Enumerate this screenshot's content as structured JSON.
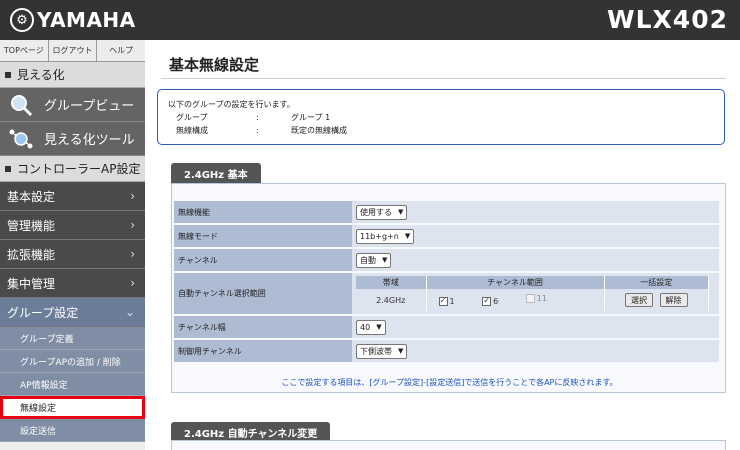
{
  "header": {
    "logo_mark": "⚙",
    "brand": "YAMAHA",
    "model": "WLX402",
    "background_color": "#333333"
  },
  "sidebar": {
    "topnav": [
      "TOPページ",
      "ログアウト",
      "ヘルプ"
    ],
    "section_visualize": "見える化",
    "tools": [
      {
        "label": "グループビュー",
        "icon": "magnifier-icon"
      },
      {
        "label": "見える化ツール",
        "icon": "network-tool-icon"
      }
    ],
    "section_controller": "コントローラーAP設定",
    "menu": [
      {
        "label": "基本設定"
      },
      {
        "label": "管理機能"
      },
      {
        "label": "拡張機能"
      },
      {
        "label": "集中管理"
      },
      {
        "label": "グループ設定"
      }
    ],
    "submenu": [
      {
        "label": "グループ定義"
      },
      {
        "label": "グループAPの追加 / 削除"
      },
      {
        "label": "AP情報設定"
      },
      {
        "label": "無線設定"
      },
      {
        "label": "設定送信"
      }
    ],
    "active_color": "#6b7d99",
    "highlight_color": "#e60012"
  },
  "main": {
    "title": "基本無線設定",
    "info": {
      "intro": "以下のグループの設定を行います。",
      "rows": [
        {
          "key": "グループ",
          "colon": ":",
          "value": "グループ 1"
        },
        {
          "key": "無線構成",
          "colon": ":",
          "value": "既定の無線構成"
        }
      ]
    },
    "tab1": "2.4GHz 基本",
    "form": {
      "wireless_function": {
        "label": "無線機能",
        "value": "使用する"
      },
      "wireless_mode": {
        "label": "無線モード",
        "value": "11b+g+n"
      },
      "channel": {
        "label": "チャンネル",
        "value": "自動"
      },
      "auto_channel": {
        "label": "自動チャンネル選択範囲",
        "headers": [
          "帯域",
          "チャンネル範囲",
          "一括設定"
        ],
        "band": "2.4GHz",
        "channels": [
          {
            "num": "1",
            "checked": true,
            "disabled": false
          },
          {
            "num": "6",
            "checked": true,
            "disabled": false
          },
          {
            "num": "11",
            "checked": false,
            "disabled": true
          }
        ],
        "select_button": "選択",
        "clear_button": "解除"
      },
      "channel_width": {
        "label": "チャンネル幅",
        "value": "40"
      },
      "control_channel": {
        "label": "制御用チャンネル",
        "value": "下側波帯"
      }
    },
    "note": "ここで設定する項目は、[グループ設定]-[設定送信]で送信を行うことで各APに反映されます。",
    "tab2": "2.4GHz 自動チャンネル変更",
    "accent_color": "#2d5fb3"
  }
}
